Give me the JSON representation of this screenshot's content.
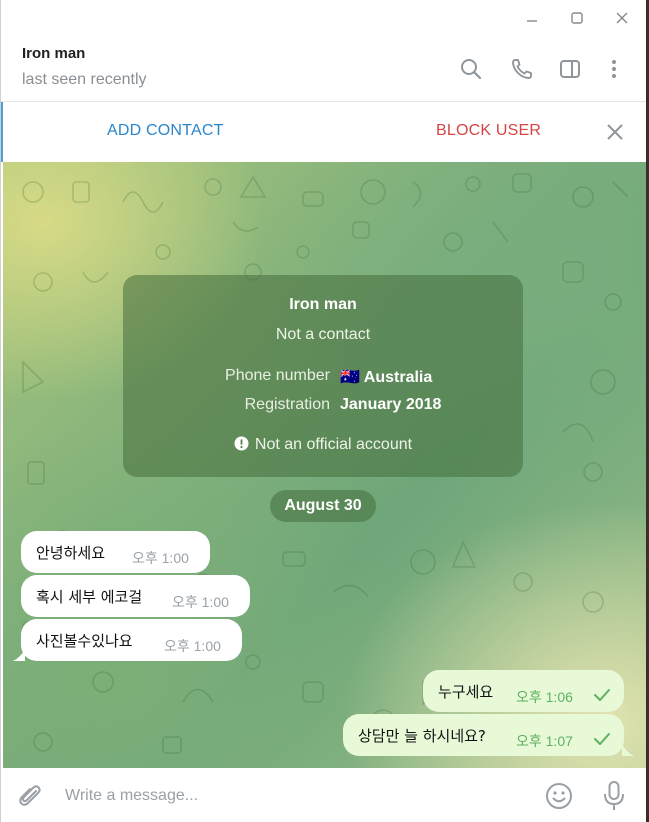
{
  "window": {
    "controls": {
      "minimize_icon": "minimize-icon",
      "maximize_icon": "maximize-icon",
      "close_icon": "close-icon"
    }
  },
  "header": {
    "name": "Iron man",
    "status": "last seen recently",
    "icons": [
      "search-icon",
      "phone-icon",
      "sidebar-icon",
      "more-vertical-icon"
    ]
  },
  "action_bar": {
    "add_contact": "ADD CONTACT",
    "block_user": "BLOCK USER"
  },
  "info_card": {
    "name": "Iron man",
    "subtitle": "Not a contact",
    "phone_label": "Phone number",
    "phone_flag": "🇦🇺",
    "phone_value": "Australia",
    "registration_label": "Registration",
    "registration_value": "January 2018",
    "note": "Not an official account"
  },
  "date_separator": "August 30",
  "messages": [
    {
      "direction": "in",
      "text": "안녕하세요",
      "time": "오후 1:00"
    },
    {
      "direction": "in",
      "text": "혹시 세부 에코걸",
      "time": "오후 1:00"
    },
    {
      "direction": "in",
      "text": "사진볼수있나요",
      "time": "오후 1:00"
    },
    {
      "direction": "out",
      "text": "누구세요",
      "time": "오후 1:06",
      "read": true
    },
    {
      "direction": "out",
      "text": "상담만 늘 하시네요?",
      "time": "오후 1:07",
      "read": true
    }
  ],
  "composer": {
    "placeholder": "Write a message...",
    "icons": [
      "paperclip-icon",
      "emoji-icon",
      "microphone-icon"
    ]
  },
  "colors": {
    "accent": "#2b86c9",
    "danger": "#d64545",
    "outgoing_bubble": "#e7f9d7",
    "outgoing_time": "#5fb061"
  }
}
